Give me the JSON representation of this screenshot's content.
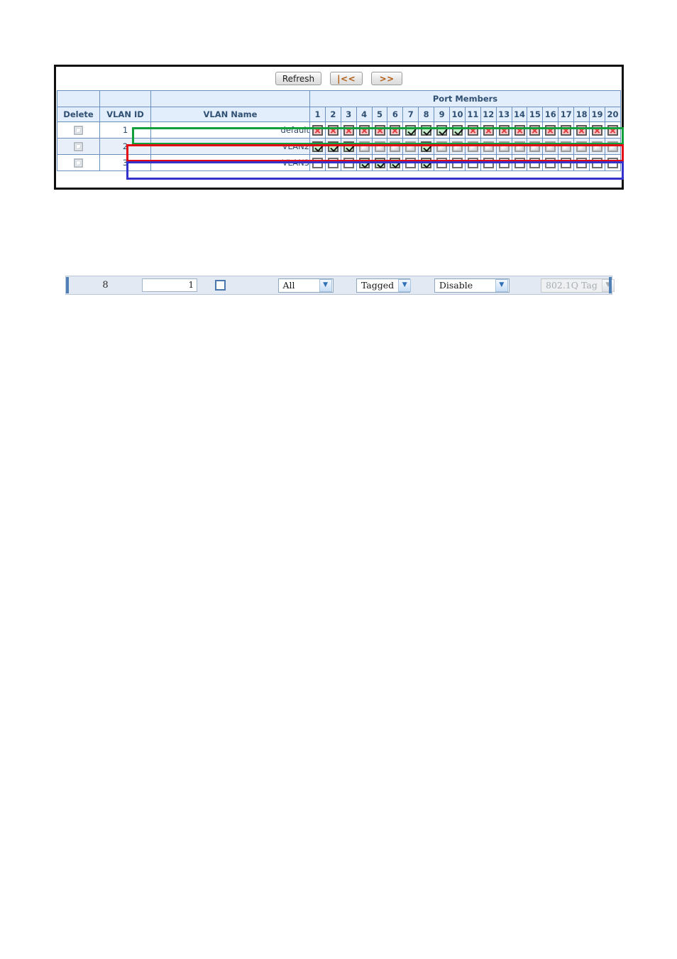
{
  "panel": {
    "toolbar": {
      "refresh_label": "Refresh",
      "first_label": "|<<",
      "next_label": ">>"
    },
    "table": {
      "group_header": "Port Members",
      "columns": {
        "delete": "Delete",
        "vlan_id": "VLAN ID",
        "vlan_name": "VLAN Name"
      },
      "port_numbers": [
        "1",
        "2",
        "3",
        "4",
        "5",
        "6",
        "7",
        "8",
        "9",
        "10",
        "11",
        "12",
        "13",
        "14",
        "15",
        "16",
        "17",
        "18",
        "19",
        "20"
      ],
      "rows": [
        {
          "delete": "unchecked-disabled",
          "vlan_id": "1",
          "vlan_name": "default",
          "ports": [
            "cross",
            "cross",
            "cross",
            "cross",
            "cross",
            "cross",
            "check",
            "check",
            "check",
            "check",
            "cross",
            "cross",
            "cross",
            "cross",
            "cross",
            "cross",
            "cross",
            "cross",
            "cross",
            "cross"
          ],
          "annotation_color": "#12a03c"
        },
        {
          "delete": "unchecked-disabled",
          "vlan_id": "2",
          "vlan_name": "VLAN2",
          "ports": [
            "check",
            "check",
            "check",
            "disabled",
            "disabled",
            "disabled",
            "disabled",
            "check",
            "disabled",
            "disabled",
            "disabled",
            "disabled",
            "disabled",
            "disabled",
            "disabled",
            "disabled",
            "disabled",
            "disabled",
            "disabled",
            "disabled"
          ],
          "annotation_color": "#e30613"
        },
        {
          "delete": "unchecked-disabled",
          "vlan_id": "3",
          "vlan_name": "VLAN3",
          "ports": [
            "empty",
            "empty",
            "empty",
            "check",
            "check",
            "check",
            "empty",
            "check",
            "empty",
            "empty",
            "empty",
            "empty",
            "empty",
            "empty",
            "empty",
            "empty",
            "empty",
            "empty",
            "empty",
            "empty"
          ],
          "annotation_color": "#3333cc"
        }
      ]
    }
  },
  "settings_strip": {
    "port_count": "8",
    "pvid_value": "1",
    "ingress_filtering": "unchecked",
    "frame_type": "All",
    "egress_tagging": "Tagged",
    "port_vlan_mode": "Disable",
    "ether_type": "802.1Q Tag",
    "ether_type_disabled": true
  },
  "colors": {
    "frame": "#101010",
    "table_border": "#6b90bd",
    "header_bg": "#e2eefb",
    "header_text": "#2f4f73",
    "alt_row_bg": "#e8eff8",
    "check_bg": "#c6edca",
    "cross_bg": "#f6c9c9",
    "cross_mark": "#e04040",
    "nav_button_text": "#b25a10",
    "strip_bg": "#e2e9f2",
    "strip_edge": "#4f7fb5",
    "annot_green": "#12a03c",
    "annot_red": "#e30613",
    "annot_blue": "#3333cc"
  }
}
